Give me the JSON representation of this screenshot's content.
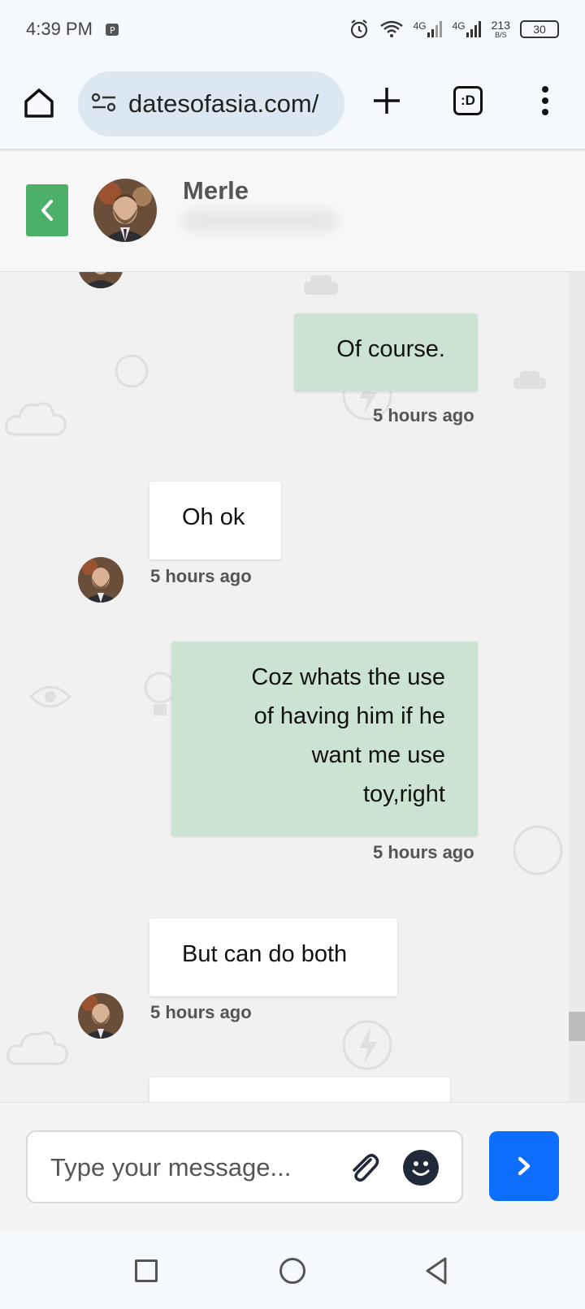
{
  "status_bar": {
    "time": "4:39 PM",
    "network_1": "4G",
    "network_2": "4G",
    "speed_value": "213",
    "speed_unit": "B/S",
    "battery": "30"
  },
  "browser": {
    "url": "datesofasia.com/",
    "tabs_label": ":D"
  },
  "chat_header": {
    "contact_name": "Merle"
  },
  "messages": [
    {
      "direction": "outgoing",
      "text": "Of course.",
      "time": "5 hours ago"
    },
    {
      "direction": "incoming",
      "text": "Oh ok",
      "time": "5 hours ago"
    },
    {
      "direction": "outgoing",
      "text_lines": [
        "Coz whats the use",
        "of having him if he",
        "want me use",
        "toy,right"
      ],
      "time": "5 hours ago"
    },
    {
      "direction": "incoming",
      "text": "But can do both",
      "time": "5 hours ago"
    }
  ],
  "composer": {
    "placeholder": "Type your message...",
    "attach_icon": "paperclip-icon",
    "emoji_icon": "smiley-icon",
    "send_icon": "chevron-right-icon"
  },
  "colors": {
    "back_button": "#4caf6a",
    "outgoing_bubble": "#cce3d3",
    "incoming_bubble": "#ffffff",
    "send_button": "#0d6efd"
  }
}
